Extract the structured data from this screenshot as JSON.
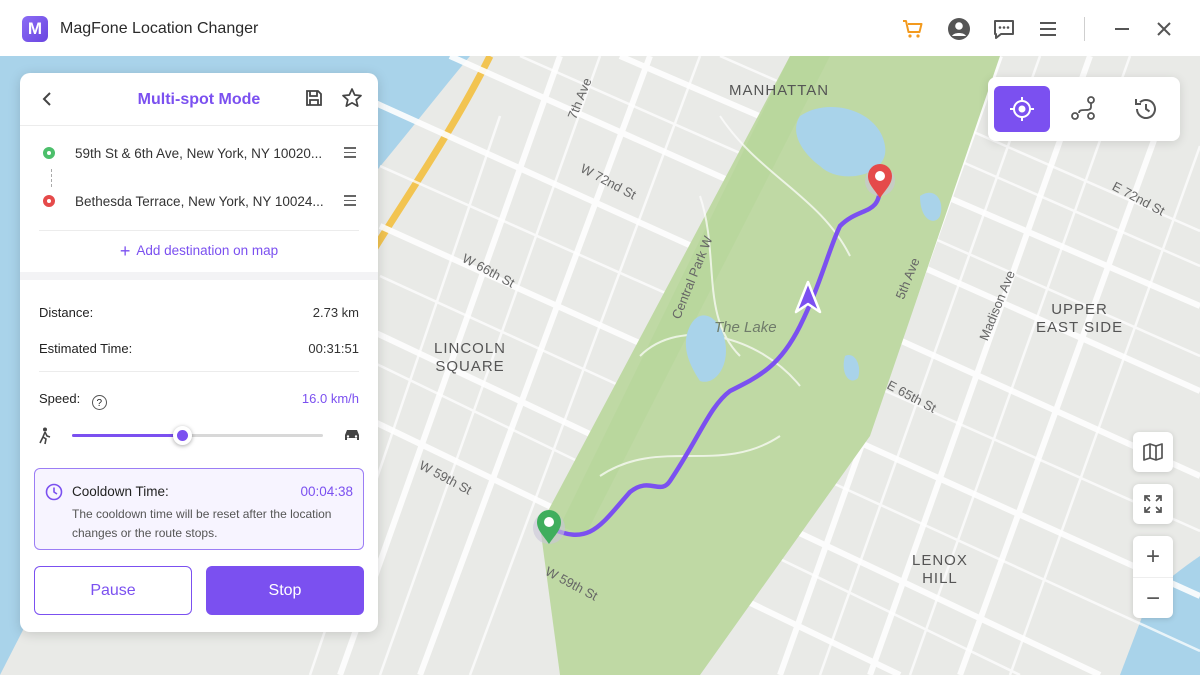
{
  "titlebar": {
    "logo_letter": "M",
    "app_title": "MagFone Location Changer",
    "icons": [
      "cart-icon",
      "account-icon",
      "chat-icon",
      "menu-icon",
      "minimize-icon",
      "close-icon"
    ]
  },
  "panel": {
    "title": "Multi-spot Mode",
    "route": [
      {
        "address": "59th St & 6th Ave, New York, NY 10020...",
        "type": "start",
        "color": "#4cbf6b"
      },
      {
        "address": "Bethesda Terrace, New York, NY 10024...",
        "type": "end",
        "color": "#e54a4a"
      }
    ],
    "add_destination": "Add destination on map",
    "distance_label": "Distance:",
    "distance_value": "2.73 km",
    "time_label": "Estimated Time:",
    "time_value": "00:31:51",
    "speed_label": "Speed:",
    "speed_value": "16.0 km/h",
    "speed_fraction": 0.44,
    "cooldown_label": "Cooldown Time:",
    "cooldown_value": "00:04:38",
    "cooldown_desc": "The cooldown time will be reset after the location changes or the route stops.",
    "pause_label": "Pause",
    "stop_label": "Stop"
  },
  "map": {
    "labels": {
      "manhattan": "MANHATTAN",
      "lincoln_1": "LINCOLN",
      "lincoln_2": "SQUARE",
      "upper_1": "UPPER",
      "upper_2": "EAST SIDE",
      "lenox_1": "LENOX",
      "lenox_2": "HILL",
      "the_lake": "The Lake",
      "w72": "W 72nd St",
      "w66": "W 66th St",
      "w59a": "W 59th St",
      "w59b": "W 59th St",
      "cpw": "Central Park W",
      "fifth": "5th Ave",
      "madison": "Madison Ave",
      "e72": "E 72nd St",
      "e65": "E 65th St",
      "seventh": "7th Ave"
    }
  },
  "colors": {
    "accent": "#7b50f0",
    "park": "#bfd9a4",
    "water": "#a9d3ea"
  }
}
